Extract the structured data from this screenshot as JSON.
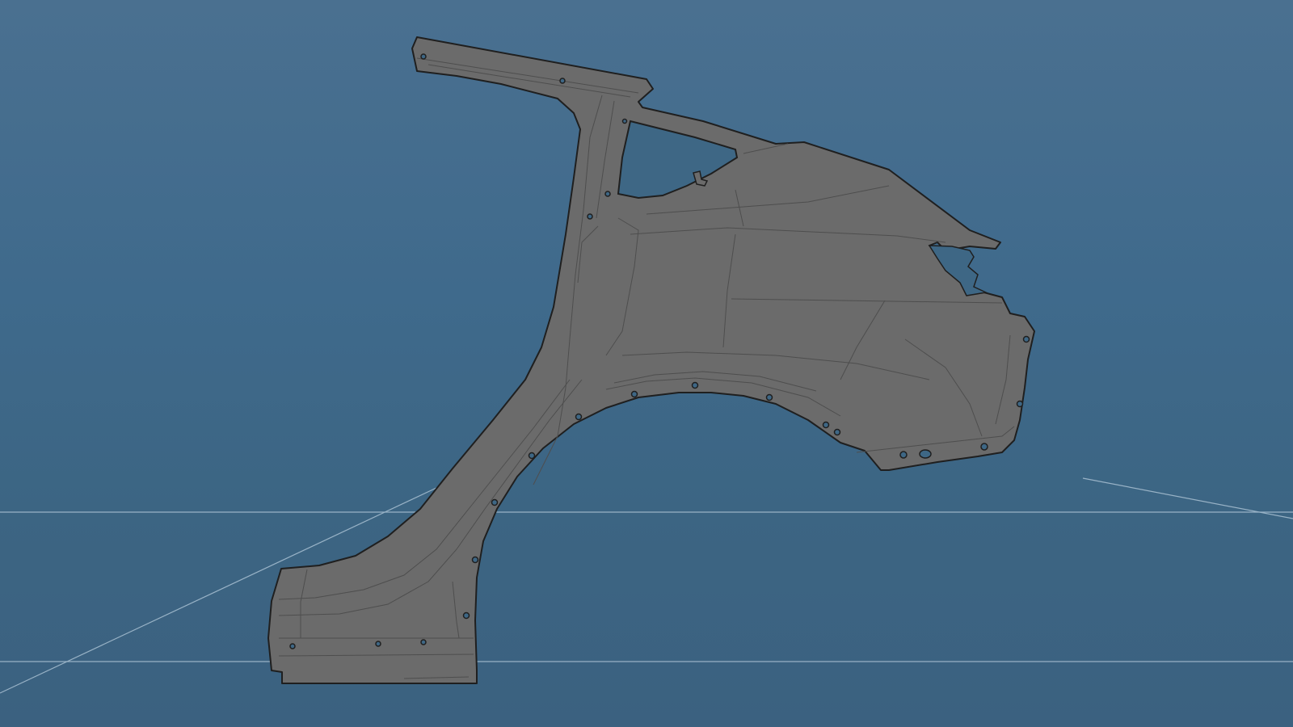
{
  "viewport": {
    "background_top": "#4a7090",
    "background_bottom": "#3b6180",
    "grid_color": "#a9c0d2",
    "panel_fill": "#6b6b6b",
    "panel_stroke": "#1f1f1f",
    "panel_line": "#4e4e4e",
    "hole_fill": "#3e6785"
  },
  "object": {
    "icon": "car-rear-quarter-panel"
  }
}
